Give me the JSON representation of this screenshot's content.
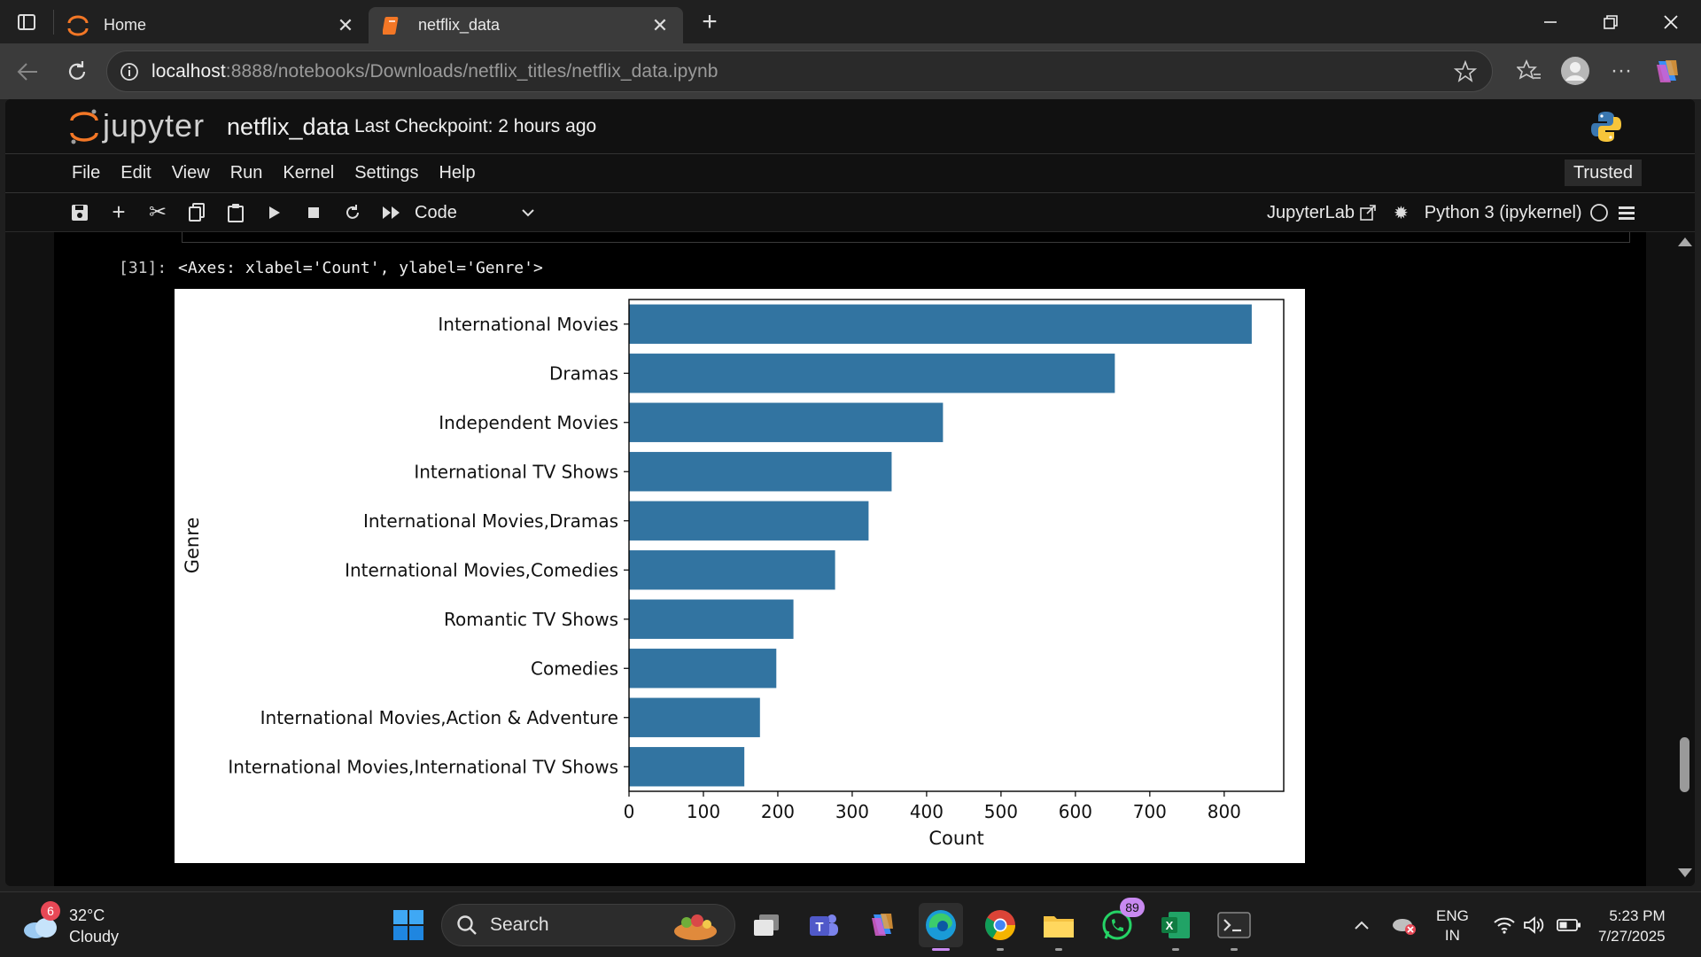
{
  "browser": {
    "tabs": [
      {
        "title": "Home",
        "active": false
      },
      {
        "title": "netflix_data",
        "active": true
      }
    ],
    "url_host": "localhost",
    "url_rest": ":8888/notebooks/Downloads/netflix_titles/netflix_data.ipynb"
  },
  "jupyter": {
    "logo_text": "jupyter",
    "notebook_name": "netflix_data",
    "checkpoint": "Last Checkpoint: 2 hours ago",
    "menu": [
      "File",
      "Edit",
      "View",
      "Run",
      "Kernel",
      "Settings",
      "Help"
    ],
    "trusted": "Trusted",
    "cell_type": "Code",
    "jupyterlab_link": "JupyterLab",
    "kernel": "Python 3 (ipykernel)"
  },
  "cell": {
    "prompt": "[31]:",
    "output_text": "<Axes: xlabel='Count', ylabel='Genre'>"
  },
  "chart_data": {
    "type": "bar",
    "orientation": "horizontal",
    "categories": [
      "International Movies",
      "Dramas",
      "Independent Movies",
      "International TV Shows",
      "International Movies,Dramas",
      "International Movies,Comedies",
      "Romantic TV Shows",
      "Comedies",
      "International Movies,Action & Adventure",
      "International Movies,International TV Shows"
    ],
    "values": [
      837,
      653,
      422,
      353,
      322,
      277,
      221,
      198,
      176,
      155
    ],
    "xlabel": "Count",
    "ylabel": "Genre",
    "xlim": [
      0,
      880
    ],
    "xticks": [
      0,
      100,
      200,
      300,
      400,
      500,
      600,
      700,
      800
    ],
    "bar_color": "#3274a1",
    "grid": false
  },
  "taskbar": {
    "weather_badge": "6",
    "temperature": "32°C",
    "condition": "Cloudy",
    "search_label": "Search",
    "whatsapp_badge": "89",
    "lang_top": "ENG",
    "lang_bottom": "IN",
    "time": "5:23 PM",
    "date": "7/27/2025"
  }
}
